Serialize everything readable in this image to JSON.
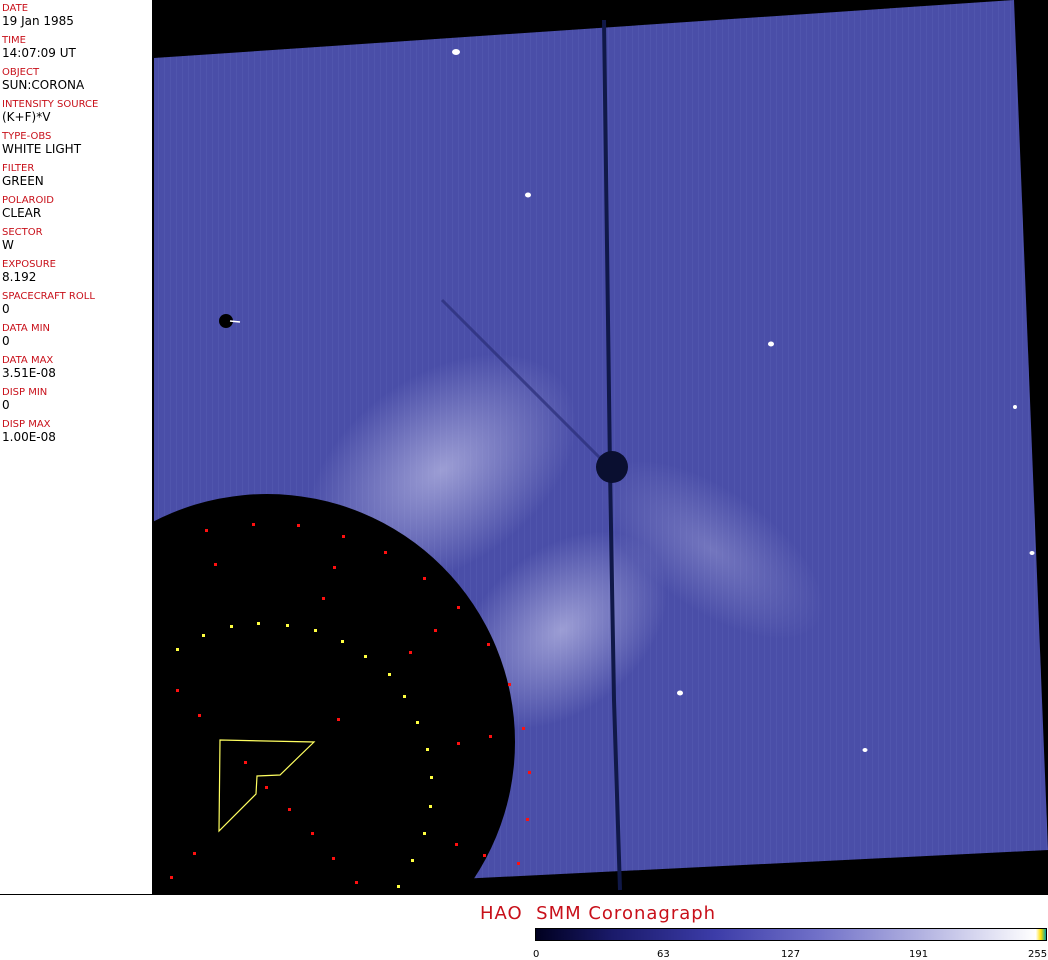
{
  "metadata_fields": [
    {
      "label": "DATE",
      "value": "19 Jan 1985"
    },
    {
      "label": "TIME",
      "value": "14:07:09 UT"
    },
    {
      "label": "OBJECT",
      "value": "SUN:CORONA"
    },
    {
      "label": "INTENSITY SOURCE",
      "value": "(K+F)*V"
    },
    {
      "label": "TYPE-OBS",
      "value": "WHITE LIGHT"
    },
    {
      "label": "FILTER",
      "value": "GREEN"
    },
    {
      "label": "POLAROID",
      "value": "CLEAR"
    },
    {
      "label": "SECTOR",
      "value": "W"
    },
    {
      "label": "EXPOSURE",
      "value": "8.192"
    },
    {
      "label": "SPACECRAFT ROLL",
      "value": "0"
    },
    {
      "label": "DATA MIN",
      "value": "0"
    },
    {
      "label": "DATA MAX",
      "value": "3.51E-08"
    },
    {
      "label": "DISP MIN",
      "value": "0"
    },
    {
      "label": "DISP MAX",
      "value": "1.00E-08"
    }
  ],
  "footer": {
    "title": "HAO  SMM Coronagraph"
  },
  "colorbar": {
    "ticks": [
      "0",
      "63",
      "127",
      "191",
      "255"
    ],
    "colors": [
      "#000020",
      "#3c3ca8",
      "#9a9ad8",
      "#ffffff"
    ]
  },
  "colors": {
    "label": "#c8101a",
    "coronagraph_field": "#4a4ea8",
    "occulter": "#000000",
    "grid_red": "#ff1010",
    "grid_yellow": "#ffff40"
  }
}
